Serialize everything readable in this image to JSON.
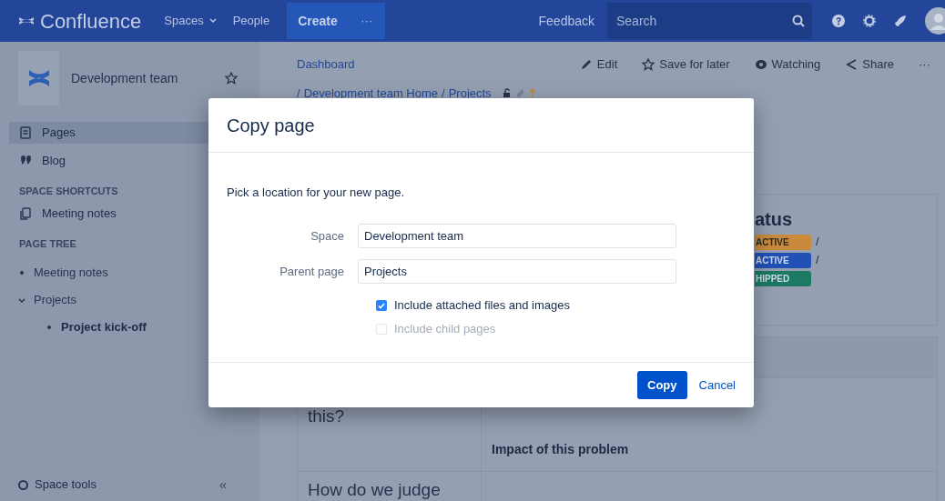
{
  "top_nav": {
    "product": "Confluence",
    "items": [
      {
        "label": "Spaces",
        "dropdown": true
      },
      {
        "label": "People",
        "dropdown": false
      }
    ],
    "create": "Create",
    "more": "···",
    "feedback": "Feedback",
    "search": {
      "placeholder": "Search"
    }
  },
  "sidebar": {
    "space_name": "Development team",
    "items": [
      {
        "label": "Pages",
        "selected": true
      },
      {
        "label": "Blog",
        "selected": false
      }
    ],
    "shortcuts": {
      "title": "SPACE SHORTCUTS",
      "items": [
        {
          "label": "Meeting notes"
        }
      ]
    },
    "page_tree": {
      "title": "PAGE TREE",
      "items": [
        {
          "label": "Meeting notes",
          "current": false
        },
        {
          "label": "Projects",
          "current": false,
          "expanded": true,
          "children": [
            {
              "label": "Project kick-off",
              "current": true
            }
          ]
        }
      ]
    },
    "space_tools": "Space tools",
    "collapse": "«"
  },
  "breadcrumbs": [
    {
      "label": "Dashboard"
    },
    {
      "prefix": "/",
      "label": "Development team Home"
    },
    {
      "prefix": "/",
      "label": "Projects"
    }
  ],
  "actions": [
    {
      "label": "Edit"
    },
    {
      "label": "Save for later"
    },
    {
      "label": "Watching"
    },
    {
      "label": "Share"
    },
    {
      "label": "···"
    }
  ],
  "content": {
    "status_heading": "atus",
    "statuses": [
      {
        "label": "ACTIVE",
        "color": "#c98a3c",
        "separator": "/"
      },
      {
        "label": "ACTIVE",
        "color": "#2251b5",
        "separator": "/"
      },
      {
        "label": "HIPPED",
        "color": "#1d7a62"
      }
    ],
    "rows": [
      {
        "column_1": "this?",
        "column_2": "Impact of this problem"
      },
      {
        "column_1": "How do we judge"
      }
    ]
  },
  "dialog": {
    "title": "Copy page",
    "description": "Pick a location for your new page.",
    "fields": [
      {
        "label": "Space",
        "value": "Development team"
      },
      {
        "label": "Parent page",
        "value": "Projects"
      }
    ],
    "options": [
      {
        "label": "Include attached files and images",
        "checked": true,
        "disabled": false
      },
      {
        "label": "Include child pages",
        "checked": false,
        "disabled": true
      }
    ],
    "buttons": [
      {
        "label": "Copy",
        "kind": "primary"
      },
      {
        "label": "Cancel",
        "kind": "link"
      }
    ]
  }
}
